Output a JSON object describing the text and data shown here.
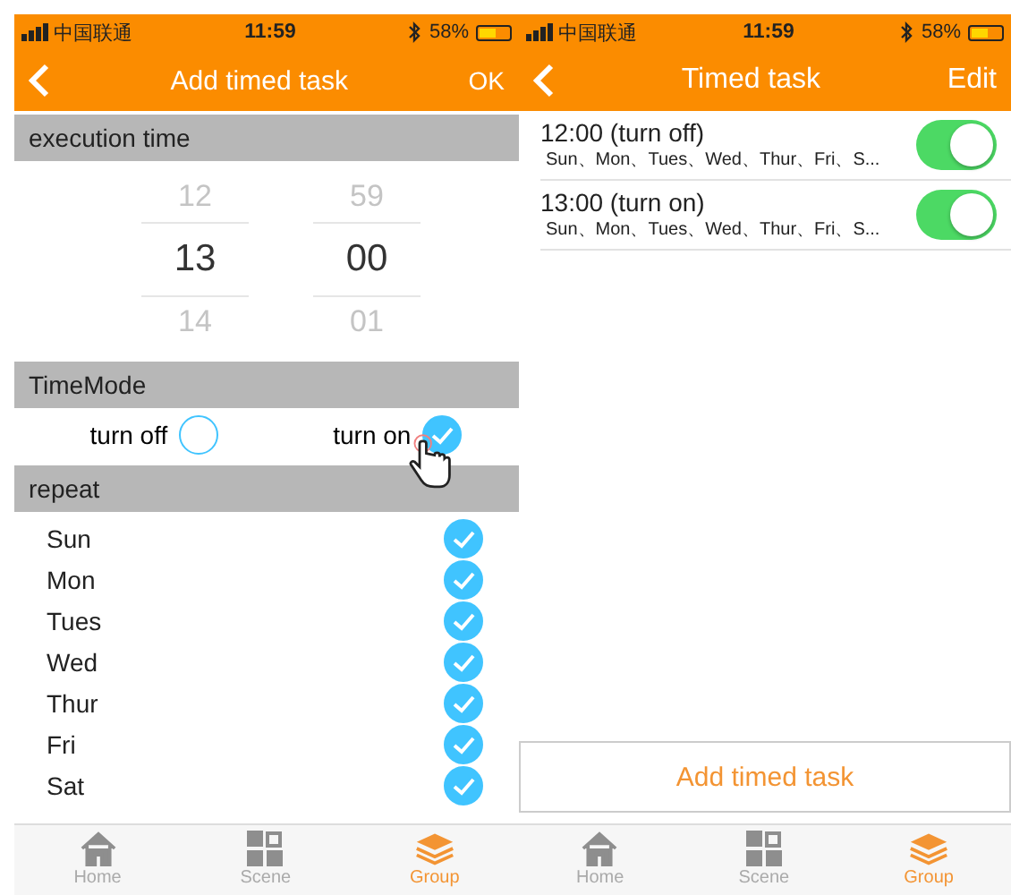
{
  "add_screen": {
    "status_bar": {
      "carrier": "中国联通",
      "time": "11:59",
      "battery": "58%",
      "level": 0.58
    },
    "nav": {
      "title": "Add timed task",
      "action": "OK"
    },
    "execution_header": "execution time",
    "picker": {
      "hours": [
        {
          "label": "12",
          "selected": false
        },
        {
          "label": "13",
          "selected": true
        },
        {
          "label": "14",
          "selected": false
        }
      ],
      "minutes": [
        {
          "label": "59",
          "selected": false
        },
        {
          "label": "00",
          "selected": true
        },
        {
          "label": "01",
          "selected": false
        }
      ]
    },
    "mode_header": "TimeMode",
    "modes": [
      {
        "label": "turn off",
        "selected": false
      },
      {
        "label": "turn on",
        "selected": true
      }
    ],
    "repeat_header": "repeat",
    "days": [
      {
        "label": "Sun",
        "checked": true
      },
      {
        "label": "Mon",
        "checked": true
      },
      {
        "label": "Tues",
        "checked": true
      },
      {
        "label": "Wed",
        "checked": true
      },
      {
        "label": "Thur",
        "checked": true
      },
      {
        "label": "Fri",
        "checked": true
      },
      {
        "label": "Sat",
        "checked": true
      }
    ],
    "tabs": [
      {
        "label": "Home",
        "selected": false
      },
      {
        "label": "Scene",
        "selected": false
      },
      {
        "label": "Group",
        "selected": true
      }
    ]
  },
  "list_screen": {
    "status_bar": {
      "carrier": "中国联通",
      "time": "11:59",
      "battery": "58%",
      "level": 0.58
    },
    "nav": {
      "title": "Timed task",
      "action": "Edit"
    },
    "tasks": [
      {
        "title": "12:00  (turn off)",
        "days": "Sun、Mon、Tues、Wed、Thur、Fri、S...",
        "on": true
      },
      {
        "title": "13:00  (turn on)",
        "days": "Sun、Mon、Tues、Wed、Thur、Fri、S...",
        "on": true
      }
    ],
    "add_button": "Add timed task",
    "tabs": [
      {
        "label": "Home",
        "selected": false
      },
      {
        "label": "Scene",
        "selected": false
      },
      {
        "label": "Group",
        "selected": true
      }
    ]
  }
}
